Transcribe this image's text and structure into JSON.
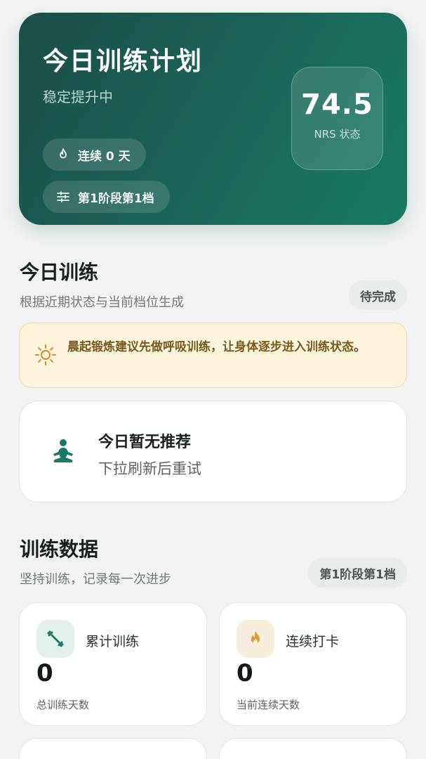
{
  "hero": {
    "title": "今日训练计划",
    "subtitle": "稳定提升中",
    "streak_label": "连续 0 天",
    "stage_label": "第1阶段第1档",
    "nrs_value": "74.5",
    "nrs_label": "NRS 状态"
  },
  "today": {
    "title": "今日训练",
    "subtitle": "根据近期状态与当前档位生成",
    "status_tag": "待完成",
    "tip": "晨起锻炼建议先做呼吸训练，让身体逐步进入训练状态。",
    "empty_title": "今日暂无推荐",
    "empty_subtitle": "下拉刷新后重试"
  },
  "stats": {
    "title": "训练数据",
    "subtitle": "坚持训练，记录每一次进步",
    "stage_tag": "第1阶段第1档",
    "cards": [
      {
        "icon": "dumbbell-icon",
        "label": "累计训练",
        "value": "0",
        "caption": "总训练天数"
      },
      {
        "icon": "flame-icon",
        "label": "连续打卡",
        "value": "0",
        "caption": "当前连续天数"
      }
    ]
  },
  "colors": {
    "accent": "#1b6457",
    "tip_bg": "#fdf4dd",
    "tip_text": "#7a5a1c",
    "orange": "#d98a2b"
  }
}
